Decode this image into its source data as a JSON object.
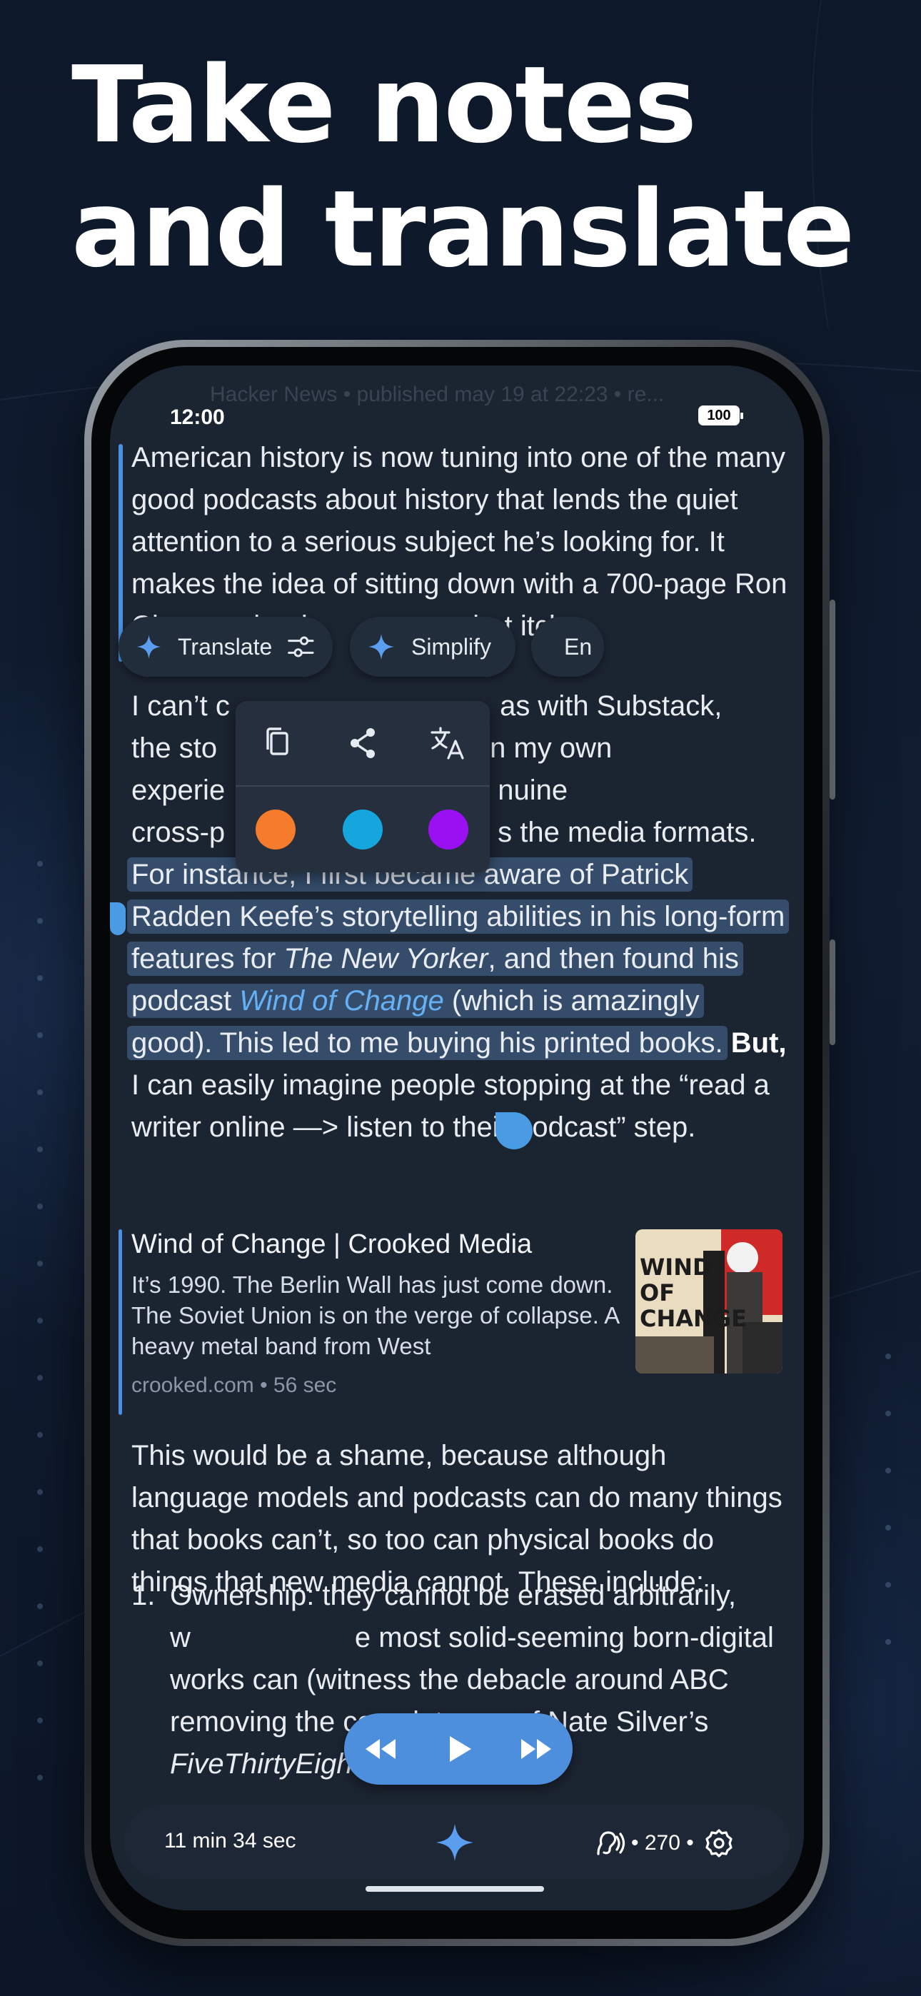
{
  "headline": {
    "line1": "Take notes",
    "line2": "and translate"
  },
  "status": {
    "time": "12:00",
    "battery": "100"
  },
  "article_header": "Hacker News • published may 19 at 22:23 • re...",
  "paragraph1": "American history is now tuning into one of the many good podcasts about history that lends the quiet attention to a serious subject he’s looking for. It makes the idea of sitting down with a 700-page Ron Chernow book ",
  "paragraph1_tail": "t",
  "paragraph1_end": "hat itch.",
  "ai_chips": {
    "translate": "Translate",
    "simplify": "Simplify",
    "third": "En"
  },
  "paragraph2_start": "I can’t c",
  "paragraph2_mid1": ", as with Substack,",
  "paragraph2_line2a": "the sto",
  "paragraph2_line2b": "n my own",
  "paragraph2_line3a": "experie",
  "paragraph2_line3b": "nuine",
  "paragraph2_line4a": "cross-p",
  "paragraph2_line4b": "s the media formats.",
  "selection": {
    "s1": "For instance, I first became aware of Patrick Radden Keefe’s storytelling abilities in his long-form features for ",
    "new_yorker": "The New Yorker",
    "s2": ", and then found his podcast ",
    "wind_link": "Wind of Change",
    "s3": " (which is amazingly good). This led to me buying his printed books."
  },
  "paragraph2_but": "But,",
  "paragraph2_rest": " I can easily imagine people stopping at the “read a writer online —> listen to their podcast” step.",
  "highlight_colors": {
    "orange": "#f47c2c",
    "cyan": "#14a6dc",
    "purple": "#9b10f2"
  },
  "link_card": {
    "title": "Wind of Change | Crooked Media",
    "description": "It’s 1990. The Berlin Wall has just come down. The Soviet Union is on the verge of collapse. A heavy metal band from West",
    "meta": "crooked.com • 56 sec",
    "image_text": "WIND OF CHANGE"
  },
  "paragraph3": "This would be a shame, because although language models and podcasts can do many things that books can’t, so too can physical books do things that new media cannot. These include:",
  "list": {
    "number": "1.",
    "text_a": "Ownership: they cannot be erased arbitrarily, w",
    "text_b": "e most solid-seeming born-digital works can (witness the debacle around ABC removing the complete run of Nate Silver’s ",
    "text_c": "FiveThirtyEight",
    "text_d": ")."
  },
  "bottom_bar": {
    "time_left": "11 min 34 sec",
    "speed": "270"
  },
  "accent": "#4a90e2"
}
